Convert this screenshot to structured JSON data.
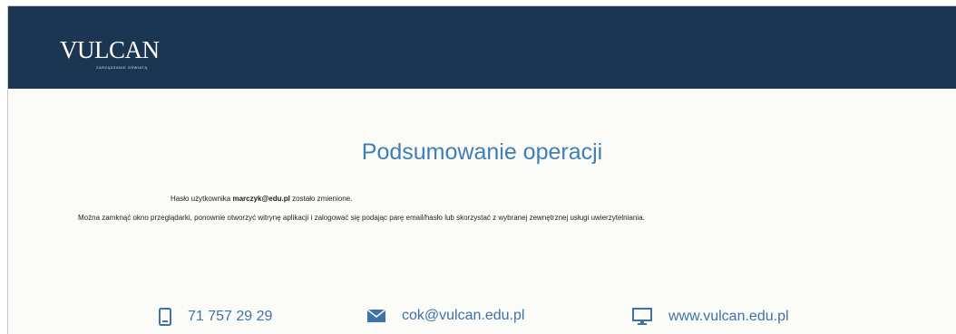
{
  "header": {
    "logo_text": "VULCAN",
    "logo_tagline": "ZARZĄDZANIE OŚWIATĄ",
    "background": "#1b3652"
  },
  "main": {
    "title": "Podsumowanie operacji",
    "message_prefix": "Hasło użytkownika ",
    "message_user": "marczyk@edu.pl",
    "message_suffix": " zostało zmienione.",
    "message_details": "Można zamknąć okno przeglądarki, ponownie otworzyć witrynę aplikacji i zalogować się podając parę email/hasło lub skorzystać z wybranej zewnętrznej usługi uwierzytelniania."
  },
  "footer": {
    "phone": "71 757 29 29",
    "email": "cok@vulcan.edu.pl",
    "website": "www.vulcan.edu.pl",
    "icons": [
      "phone-icon",
      "mail-icon",
      "monitor-icon"
    ],
    "accent": "#3d73a8"
  }
}
